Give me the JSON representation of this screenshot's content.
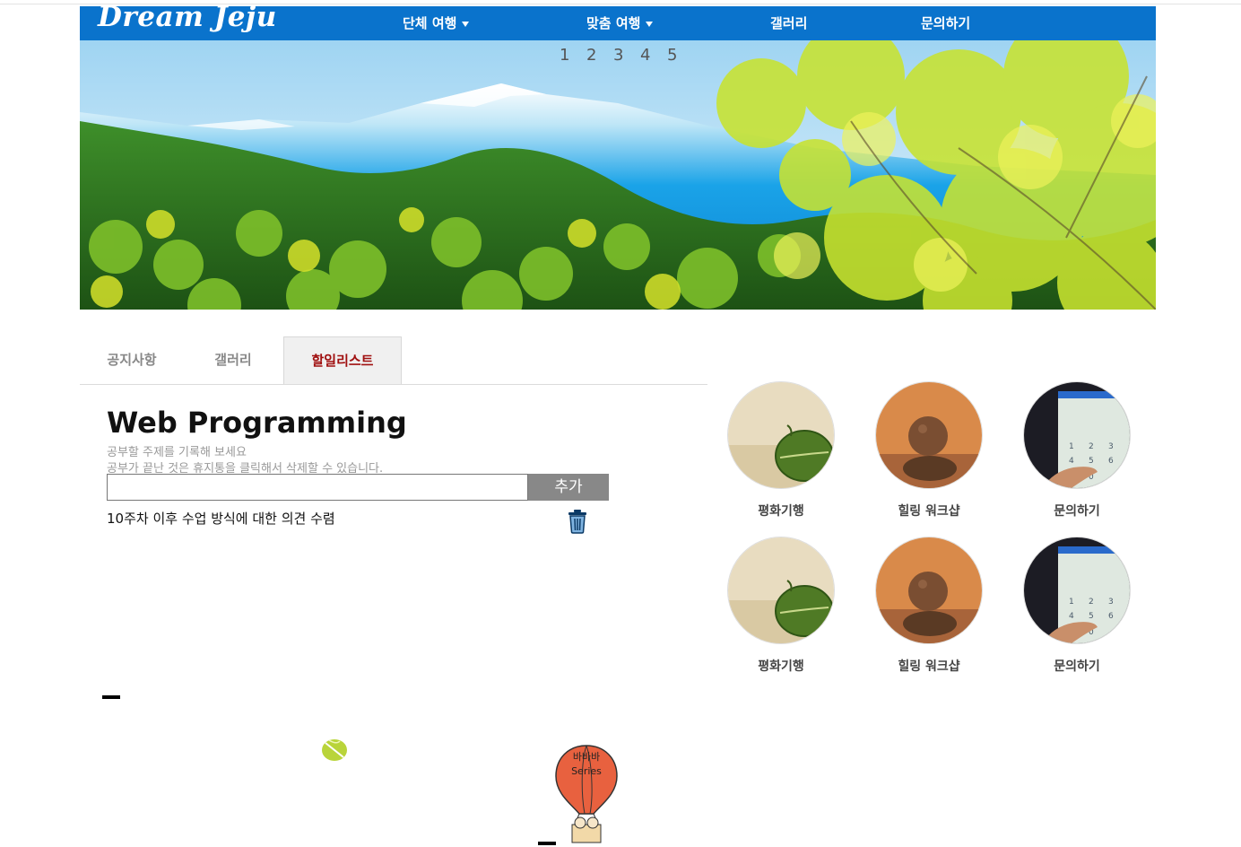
{
  "nav": {
    "logo": "Dream Jeju",
    "items": [
      {
        "label": "단체 여행",
        "has_dropdown": true
      },
      {
        "label": "맞춤 여행",
        "has_dropdown": true
      },
      {
        "label": "갤러리",
        "has_dropdown": false
      },
      {
        "label": "문의하기",
        "has_dropdown": false
      }
    ]
  },
  "hero": {
    "slide_numbers": [
      "1",
      "2",
      "3",
      "4",
      "5"
    ]
  },
  "tabs": [
    {
      "label": "공지사항",
      "active": false
    },
    {
      "label": "갤러리",
      "active": false
    },
    {
      "label": "할일리스트",
      "active": true
    }
  ],
  "todo": {
    "title": "Web Programming",
    "desc1": "공부할 주제를 기록해 보세요",
    "desc2": "공부가 끝난 것은 휴지통을 클릭해서 삭제할 수 있습니다.",
    "input_value": "",
    "add_label": "추가",
    "items": [
      "10주차 이후 수업 방식에 대한 의견 수렴"
    ]
  },
  "gallery": [
    {
      "label": "평화기행",
      "image": "leaf-on-sand"
    },
    {
      "label": "힐링 워크샵",
      "image": "stacked-stones"
    },
    {
      "label": "문의하기",
      "image": "phone-keypad"
    },
    {
      "label": "평화기행",
      "image": "leaf-on-sand"
    },
    {
      "label": "힐링 워크샵",
      "image": "stacked-stones"
    },
    {
      "label": "문의하기",
      "image": "phone-keypad"
    }
  ],
  "decor": {
    "balloon_text_1": "바바바",
    "balloon_text_2": "Series"
  },
  "colors": {
    "nav_bg": "#0a73cc",
    "active_tab_text": "#a01010",
    "add_button_bg": "#888888"
  }
}
